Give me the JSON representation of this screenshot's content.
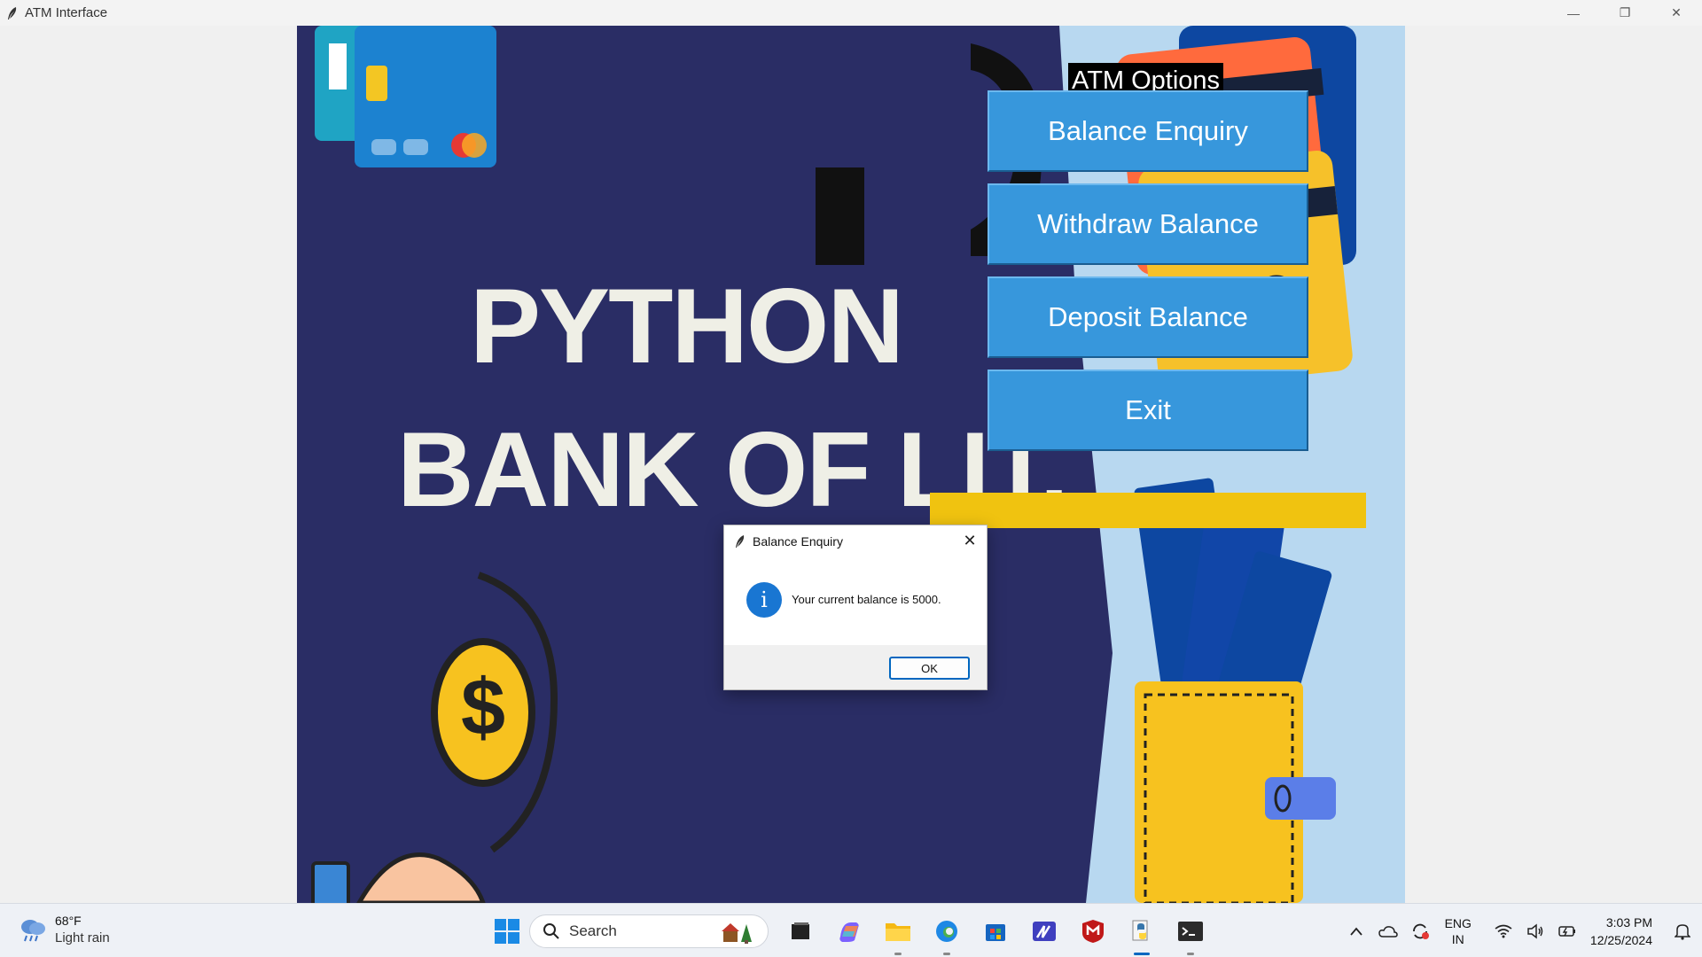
{
  "window": {
    "title": "ATM Interface",
    "controls": {
      "minimize": "—",
      "restore": "❐",
      "close": "✕"
    }
  },
  "poster": {
    "line1": "PYTHON",
    "line2": "BANK OF LIT."
  },
  "atm": {
    "heading": "ATM Options",
    "buttons": [
      {
        "label": "Balance Enquiry"
      },
      {
        "label": "Withdraw Balance"
      },
      {
        "label": "Deposit Balance"
      },
      {
        "label": "Exit"
      }
    ],
    "colors": {
      "button": "#3797dc",
      "background": "#2a2d65",
      "accent_bar": "#f0c310",
      "light_panel": "#b8d8f0"
    }
  },
  "dialog": {
    "title": "Balance Enquiry",
    "icon": "info-icon",
    "message": "Your current balance is 5000.",
    "ok_label": "OK",
    "close_glyph": "✕"
  },
  "taskbar": {
    "weather": {
      "temperature": "68°F",
      "condition": "Light rain"
    },
    "search_placeholder": "Search",
    "apps": [
      "task-view-icon",
      "copilot-icon",
      "file-explorer-icon",
      "edge-icon",
      "store-icon",
      "editor-icon",
      "mcafee-icon",
      "python-icon",
      "terminal-icon"
    ],
    "tray": {
      "language": {
        "line1": "ENG",
        "line2": "IN"
      },
      "time": "3:03 PM",
      "date": "12/25/2024"
    }
  }
}
